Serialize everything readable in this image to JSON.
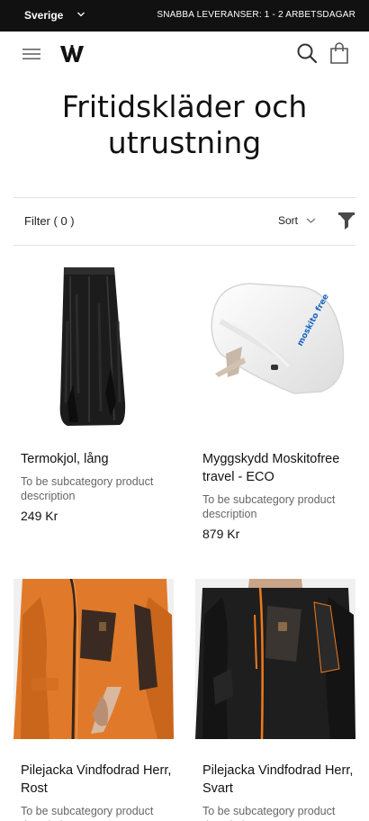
{
  "topbar": {
    "country": "Sverige",
    "promo": "SNABBA LEVERANSER: 1 - 2 ARBETSDAGAR"
  },
  "header": {
    "menu_icon": "hamburger-menu-icon",
    "logo_icon": "brand-logo-icon",
    "search_icon": "search-icon",
    "cart_icon": "shopping-bag-icon"
  },
  "page": {
    "title": "Fritidskläder och utrustning"
  },
  "toolbar": {
    "filter_label": "Filter ( 0 )",
    "sort_label": "Sort",
    "funnel_icon": "filter-funnel-icon"
  },
  "products": [
    {
      "name": "Termokjol, lång",
      "description": "To be subcategory product description",
      "price": "249 Kr"
    },
    {
      "name": "Myggskydd Moskitofree travel - ECO",
      "description": "To be subcategory product description",
      "price": "879 Kr",
      "device_label": "moskito free"
    },
    {
      "name": "Pilejacka Vindfodrad Herr, Rost",
      "description": "To be subcategory product description"
    },
    {
      "name": "Pilejacka Vindfodrad Herr, Svart",
      "description": "To be subcategory product description"
    }
  ],
  "colors": {
    "topbar_bg": "#111111",
    "accent_icon": "#4a4a4a",
    "jacket_orange": "#e07a2a",
    "jacket_black": "#1e1e1e"
  }
}
